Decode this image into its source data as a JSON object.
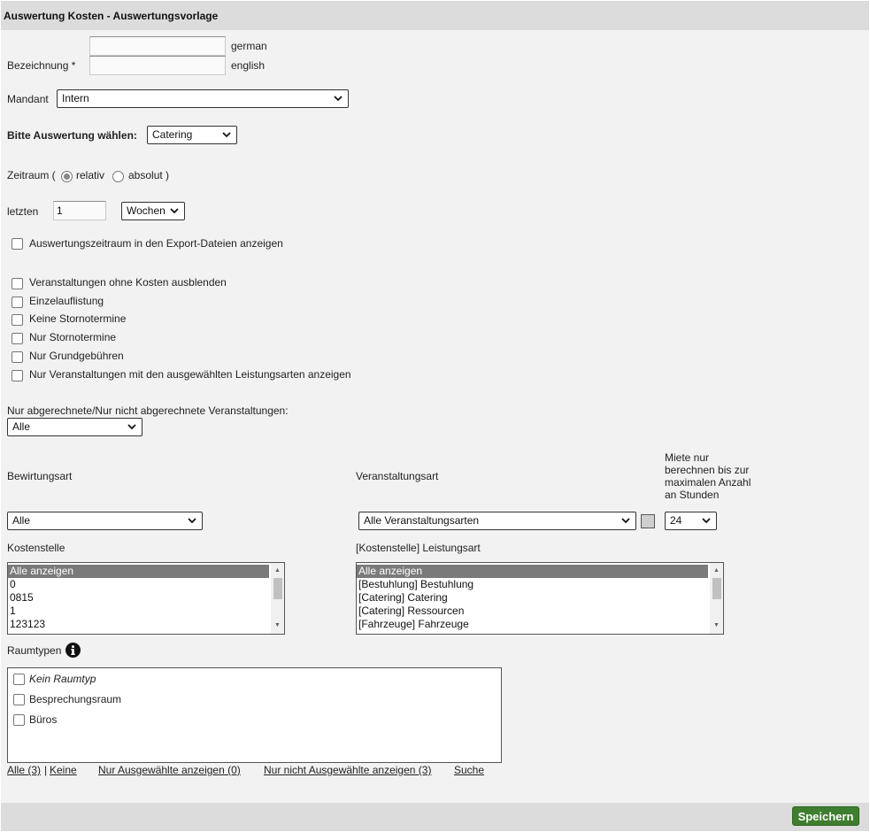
{
  "page": {
    "title": "Auswertung Kosten - Auswertungsvorlage"
  },
  "bezeichnung": {
    "label": "Bezeichnung *",
    "german_value": "",
    "german_label": "german",
    "english_value": "",
    "english_label": "english"
  },
  "mandant": {
    "label": "Mandant",
    "value": "Intern"
  },
  "auswertung": {
    "label": "Bitte Auswertung wählen:",
    "value": "Catering"
  },
  "zeitraum": {
    "label": "Zeitraum (",
    "relativ": "relativ",
    "absolut": "absolut )",
    "selected": "relativ"
  },
  "letzten": {
    "label": "letzten",
    "value": "1",
    "unit": "Wochen"
  },
  "export_checkbox": {
    "label": "Auswertungszeitraum in den Export-Dateien anzeigen",
    "checked": false
  },
  "options": [
    {
      "label": "Veranstaltungen ohne Kosten ausblenden",
      "checked": false
    },
    {
      "label": "Einzelauflistung",
      "checked": false
    },
    {
      "label": "Keine Stornotermine",
      "checked": false
    },
    {
      "label": "Nur Stornotermine",
      "checked": false
    },
    {
      "label": "Nur Grundgebühren",
      "checked": false
    },
    {
      "label": "Nur Veranstaltungen mit den ausgewählten Leistungsarten anzeigen",
      "checked": false
    }
  ],
  "abgerechnet": {
    "label": "Nur abgerechnete/Nur nicht abgerechnete Veranstaltungen:",
    "value": "Alle"
  },
  "bewirtungsart": {
    "label": "Bewirtungsart",
    "value": "Alle"
  },
  "veranstaltungsart": {
    "label": "Veranstaltungsart",
    "value": "Alle Veranstaltungsarten"
  },
  "miete": {
    "label_lines": [
      "Miete nur",
      "berechnen bis zur",
      "maximalen Anzahl",
      "an Stunden"
    ],
    "value": "24"
  },
  "kostenstelle": {
    "label": "Kostenstelle",
    "items": [
      "Alle anzeigen",
      "0",
      "0815",
      "1",
      "123123"
    ],
    "selected_index": 0
  },
  "leistungsart": {
    "label": "[Kostenstelle] Leistungsart",
    "items": [
      "Alle anzeigen",
      "[Bestuhlung] Bestuhlung",
      "[Catering] Catering",
      "[Catering] Ressourcen",
      "[Fahrzeuge] Fahrzeuge"
    ],
    "selected_index": 0
  },
  "raumtypen": {
    "label": "Raumtypen",
    "items": [
      {
        "label": "Kein Raumtyp",
        "italic": true,
        "checked": false
      },
      {
        "label": "Besprechungsraum",
        "italic": false,
        "checked": false
      },
      {
        "label": "Büros",
        "italic": false,
        "checked": false
      }
    ],
    "links": {
      "alle": "Alle (3)",
      "sep": "|",
      "keine": "Keine",
      "nur_ausgewaehlte": "Nur Ausgewählte anzeigen (0)",
      "nur_nicht_ausgewaehlte": "Nur nicht Ausgewählte anzeigen (3)",
      "suche": "Suche"
    }
  },
  "footer": {
    "save_label": "Speichern"
  },
  "colors": {
    "title_bar": "#dcdcdc",
    "panel": "#f2f2f2",
    "save_button": "#3f7d2f",
    "list_selected": "#7a7a7a"
  },
  "icons": {
    "select_arrow": "chevron-down-icon",
    "info": "info-icon"
  }
}
